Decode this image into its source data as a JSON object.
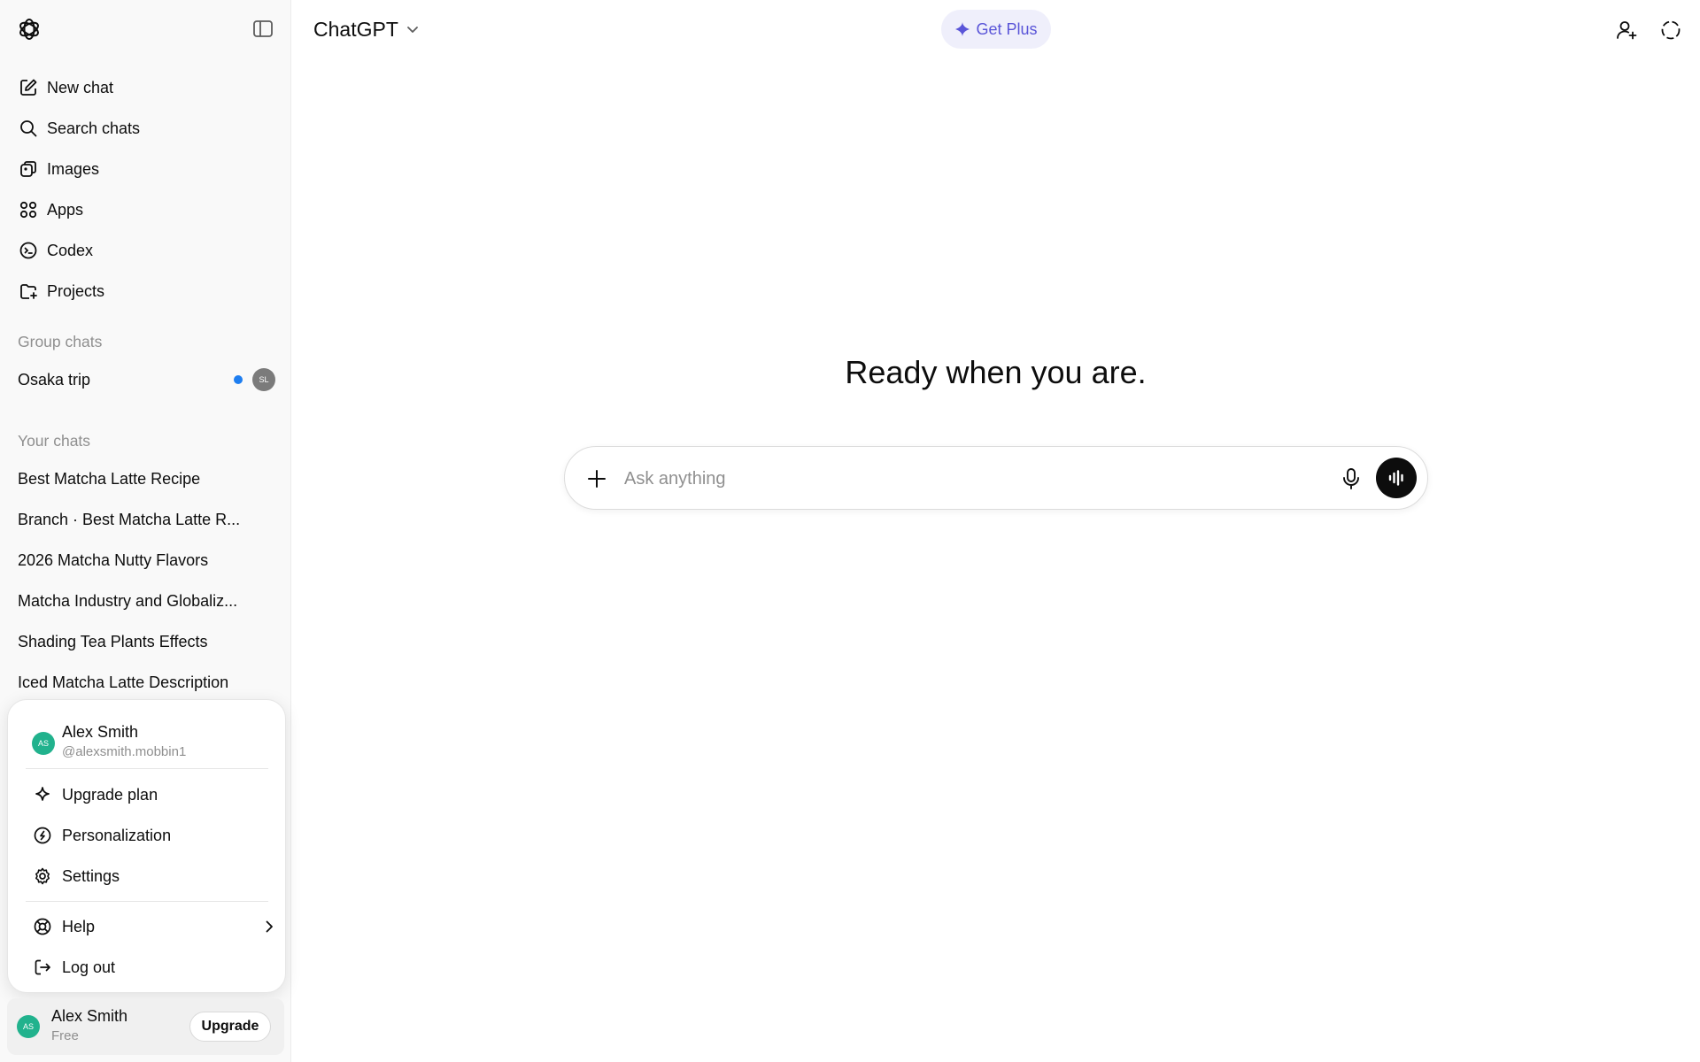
{
  "sidebar": {
    "nav": [
      {
        "label": "New chat",
        "icon": "new-chat-icon"
      },
      {
        "label": "Search chats",
        "icon": "search-icon"
      },
      {
        "label": "Images",
        "icon": "images-icon"
      },
      {
        "label": "Apps",
        "icon": "apps-icon"
      },
      {
        "label": "Codex",
        "icon": "codex-icon"
      },
      {
        "label": "Projects",
        "icon": "projects-icon"
      }
    ],
    "group_chats_heading": "Group chats",
    "group_chats": [
      {
        "label": "Osaka trip",
        "avatar_initials": "SL",
        "unread": true
      }
    ],
    "your_chats_heading": "Your chats",
    "chats": [
      "Best Matcha Latte Recipe",
      "Branch · Best Matcha Latte R...",
      "2026 Matcha Nutty Flavors",
      "Matcha Industry and Globaliz...",
      "Shading Tea Plants Effects",
      "Iced Matcha Latte Description"
    ]
  },
  "menu": {
    "name": "Alex Smith",
    "handle": "@alexsmith.mobbin1",
    "avatar_initials": "AS",
    "items": [
      {
        "label": "Upgrade plan",
        "icon": "sparkle-icon"
      },
      {
        "label": "Personalization",
        "icon": "personalization-icon"
      },
      {
        "label": "Settings",
        "icon": "gear-icon"
      },
      {
        "label": "Help",
        "icon": "help-icon"
      },
      {
        "label": "Log out",
        "icon": "logout-icon"
      }
    ]
  },
  "account": {
    "name": "Alex Smith",
    "plan": "Free",
    "avatar_initials": "AS",
    "upgrade_label": "Upgrade"
  },
  "header": {
    "model": "ChatGPT",
    "get_plus": "Get Plus"
  },
  "main": {
    "hero": "Ready when you are.",
    "placeholder": "Ask anything"
  },
  "colors": {
    "accent": "#5a55d8",
    "unread_dot": "#1e7ef0",
    "avatar_green": "#21b28d"
  }
}
